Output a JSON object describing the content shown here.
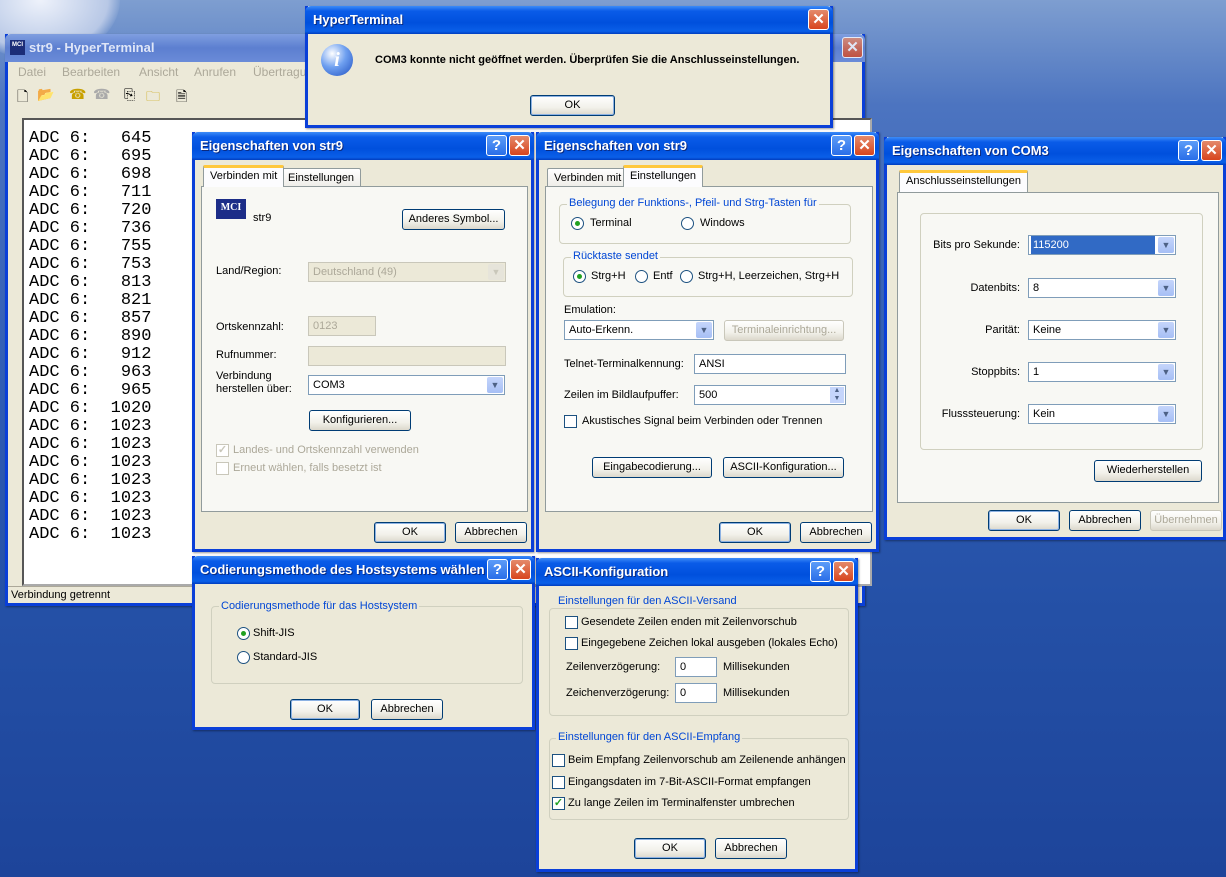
{
  "main": {
    "title": "str9 - HyperTerminal",
    "menu": [
      "Datei",
      "Bearbeiten",
      "Ansicht",
      "Anrufen",
      "Übertragung"
    ],
    "toolbar": [
      "new-icon",
      "open-icon",
      "connect-icon",
      "disconnect-icon",
      "send-icon",
      "receive-icon",
      "properties-icon"
    ],
    "terminal_lines": [
      "ADC 6:   645",
      "ADC 6:   695",
      "ADC 6:   698",
      "ADC 6:   711",
      "ADC 6:   720",
      "ADC 6:   736",
      "ADC 6:   755",
      "ADC 6:   753",
      "ADC 6:   813",
      "ADC 6:   821",
      "ADC 6:   857",
      "ADC 6:   890",
      "ADC 6:   912",
      "ADC 6:   963",
      "ADC 6:   965",
      "ADC 6:  1020",
      "ADC 6:  1023",
      "ADC 6:  1023",
      "ADC 6:  1023",
      "ADC 6:  1023",
      "ADC 6:  1023",
      "ADC 6:  1023",
      "ADC 6:  1023"
    ],
    "status": "Verbindung getrennt"
  },
  "error": {
    "title": "HyperTerminal",
    "message": "COM3 konnte nicht geöffnet werden. Überprüfen Sie die Anschlusseinstellungen.",
    "ok": "OK"
  },
  "props1": {
    "title": "Eigenschaften von str9",
    "tabs": [
      "Verbinden mit",
      "Einstellungen"
    ],
    "name": "str9",
    "change_icon": "Anderes Symbol...",
    "country_label": "Land/Region:",
    "country": "Deutschland (49)",
    "area_label": "Ortskennzahl:",
    "area": "0123",
    "phone_label": "Rufnummer:",
    "phone": "",
    "connect_label": [
      "Verbindung",
      "herstellen über:"
    ],
    "connect": "COM3",
    "configure": "Konfigurieren...",
    "use_codes": "Landes- und Ortskennzahl verwenden",
    "redial": "Erneut wählen, falls besetzt ist",
    "ok": "OK",
    "cancel": "Abbrechen"
  },
  "props2": {
    "title": "Eigenschaften von str9",
    "tabs": [
      "Verbinden mit",
      "Einstellungen"
    ],
    "keys_group": "Belegung der Funktions-, Pfeil- und Strg-Tasten für",
    "keys_options": [
      "Terminal",
      "Windows"
    ],
    "backspace_group": "Rücktaste sendet",
    "backspace_options": [
      "Strg+H",
      "Entf",
      "Strg+H, Leerzeichen, Strg+H"
    ],
    "emulation_label": "Emulation:",
    "emulation": "Auto-Erkenn.",
    "terminal_setup": "Terminaleinrichtung...",
    "telnet_label": "Telnet-Terminalkennung:",
    "telnet": "ANSI",
    "buffer_label": "Zeilen im Bildlaufpuffer:",
    "buffer": "500",
    "beep": "Akustisches Signal beim Verbinden oder Trennen",
    "input_encoding": "Eingabecodierung...",
    "ascii_setup": "ASCII-Konfiguration...",
    "ok": "OK",
    "cancel": "Abbrechen"
  },
  "com3": {
    "title": "Eigenschaften von COM3",
    "tab": "Anschlusseinstellungen",
    "rows": [
      {
        "label": "Bits pro Sekunde:",
        "value": "115200"
      },
      {
        "label": "Datenbits:",
        "value": "8"
      },
      {
        "label": "Parität:",
        "value": "Keine"
      },
      {
        "label": "Stoppbits:",
        "value": "1"
      },
      {
        "label": "Flusssteuerung:",
        "value": "Kein"
      }
    ],
    "restore": "Wiederherstellen",
    "ok": "OK",
    "cancel": "Abbrechen",
    "apply": "Übernehmen"
  },
  "encoding": {
    "title": "Codierungsmethode des Hostsystems wählen",
    "group": "Codierungsmethode für das Hostsystem",
    "options": [
      "Shift-JIS",
      "Standard-JIS"
    ],
    "ok": "OK",
    "cancel": "Abbrechen"
  },
  "ascii": {
    "title": "ASCII-Konfiguration",
    "send_group": "Einstellungen für den ASCII-Versand",
    "send_lf": "Gesendete Zeilen enden mit Zeilenvorschub",
    "echo": "Eingegebene Zeichen lokal ausgeben (lokales Echo)",
    "line_delay_label": "Zeilenverzögerung:",
    "line_delay": "0",
    "char_delay_label": "Zeichenverzögerung:",
    "char_delay": "0",
    "ms": "Millisekunden",
    "recv_group": "Einstellungen für den ASCII-Empfang",
    "recv_lf": "Beim Empfang Zeilenvorschub am Zeilenende anhängen",
    "seven_bit": "Eingangsdaten im 7-Bit-ASCII-Format empfangen",
    "wrap": "Zu lange Zeilen im Terminalfenster umbrechen",
    "ok": "OK",
    "cancel": "Abbrechen"
  }
}
